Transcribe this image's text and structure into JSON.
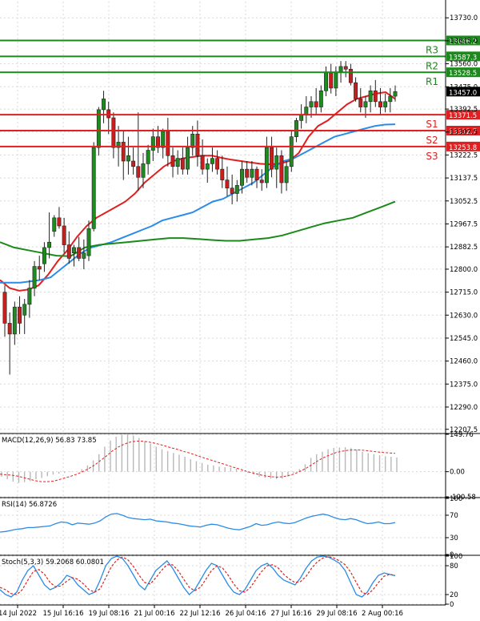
{
  "chart_data": {
    "type": "candlestick",
    "main": {
      "y_ticks": [
        "13730.0",
        "13645.0",
        "13560.0",
        "13475.0",
        "13392.5",
        "13307.5",
        "13222.5",
        "13137.5",
        "13052.5",
        "12967.5",
        "12882.5",
        "12800.0",
        "12715.0",
        "12630.0",
        "12545.0",
        "12460.0",
        "12375.0",
        "12290.0",
        "12207.5"
      ],
      "ylim": [
        12195,
        13790
      ],
      "levels": [
        {
          "name": "R3",
          "value": 13646.2,
          "label": "13646.2",
          "color": "#1a8a1a"
        },
        {
          "name": "R2",
          "value": 13587.3,
          "label": "13587.3",
          "color": "#1a8a1a"
        },
        {
          "name": "R1",
          "value": 13528.5,
          "label": "13528.5",
          "color": "#1a8a1a"
        },
        {
          "name": "S1",
          "value": 13371.5,
          "label": "13371.5",
          "color": "#e02020"
        },
        {
          "name": "S2",
          "value": 13312.7,
          "label": "13312.7",
          "color": "#e02020"
        },
        {
          "name": "S3",
          "value": 13253.8,
          "label": "13253.8",
          "color": "#e02020"
        }
      ],
      "current_price": {
        "value": 13457.0,
        "label": "13457.0"
      },
      "candles": [
        [
          12715,
          12740,
          12550,
          12600
        ],
        [
          12600,
          12640,
          12410,
          12560
        ],
        [
          12560,
          12680,
          12520,
          12660
        ],
        [
          12660,
          12700,
          12560,
          12600
        ],
        [
          12630,
          12690,
          12560,
          12670
        ],
        [
          12670,
          12760,
          12620,
          12730
        ],
        [
          12730,
          12830,
          12700,
          12810
        ],
        [
          12810,
          12850,
          12760,
          12800
        ],
        [
          12820,
          12900,
          12790,
          12880
        ],
        [
          12880,
          13010,
          12840,
          12900
        ],
        [
          12940,
          13000,
          12920,
          12990
        ],
        [
          12990,
          13030,
          12950,
          12960
        ],
        [
          12960,
          12990,
          12860,
          12890
        ],
        [
          12890,
          12940,
          12820,
          12840
        ],
        [
          12860,
          12890,
          12810,
          12880
        ],
        [
          12880,
          12920,
          12830,
          12840
        ],
        [
          12840,
          12910,
          12800,
          12860
        ],
        [
          12850,
          12980,
          12830,
          12950
        ],
        [
          12950,
          13270,
          12940,
          13250
        ],
        [
          13250,
          13400,
          13220,
          13390
        ],
        [
          13390,
          13460,
          13340,
          13430
        ],
        [
          13390,
          13420,
          13300,
          13360
        ],
        [
          13360,
          13380,
          13210,
          13250
        ],
        [
          13250,
          13330,
          13180,
          13270
        ],
        [
          13270,
          13310,
          13130,
          13200
        ],
        [
          13200,
          13290,
          13150,
          13220
        ],
        [
          13200,
          13250,
          13150,
          13180
        ],
        [
          13180,
          13380,
          13090,
          13140
        ],
        [
          13140,
          13230,
          13100,
          13190
        ],
        [
          13190,
          13260,
          13150,
          13240
        ],
        [
          13240,
          13320,
          13200,
          13290
        ],
        [
          13290,
          13330,
          13230,
          13250
        ],
        [
          13250,
          13320,
          13210,
          13310
        ],
        [
          13310,
          13360,
          13180,
          13220
        ],
        [
          13220,
          13250,
          13140,
          13180
        ],
        [
          13180,
          13240,
          13150,
          13210
        ],
        [
          13210,
          13250,
          13150,
          13170
        ],
        [
          13170,
          13290,
          13150,
          13250
        ],
        [
          13250,
          13330,
          13220,
          13300
        ],
        [
          13300,
          13350,
          13180,
          13220
        ],
        [
          13220,
          13280,
          13150,
          13170
        ],
        [
          13170,
          13210,
          13120,
          13190
        ],
        [
          13190,
          13250,
          13160,
          13210
        ],
        [
          13210,
          13240,
          13150,
          13170
        ],
        [
          13170,
          13220,
          13100,
          13130
        ],
        [
          13130,
          13180,
          13070,
          13100
        ],
        [
          13100,
          13150,
          13040,
          13080
        ],
        [
          13080,
          13130,
          13050,
          13110
        ],
        [
          13110,
          13200,
          13080,
          13170
        ],
        [
          13170,
          13200,
          13120,
          13140
        ],
        [
          13140,
          13200,
          13110,
          13170
        ],
        [
          13170,
          13180,
          13100,
          13130
        ],
        [
          13130,
          13170,
          13090,
          13120
        ],
        [
          13120,
          13290,
          13100,
          13250
        ],
        [
          13250,
          13290,
          13140,
          13170
        ],
        [
          13170,
          13250,
          13100,
          13220
        ],
        [
          13220,
          13240,
          13080,
          13120
        ],
        [
          13120,
          13200,
          13090,
          13180
        ],
        [
          13180,
          13310,
          13160,
          13290
        ],
        [
          13290,
          13360,
          13270,
          13350
        ],
        [
          13350,
          13410,
          13320,
          13370
        ],
        [
          13370,
          13440,
          13340,
          13400
        ],
        [
          13400,
          13440,
          13360,
          13420
        ],
        [
          13420,
          13470,
          13370,
          13400
        ],
        [
          13400,
          13480,
          13380,
          13460
        ],
        [
          13460,
          13550,
          13440,
          13530
        ],
        [
          13530,
          13560,
          13450,
          13470
        ],
        [
          13470,
          13550,
          13440,
          13530
        ],
        [
          13530,
          13570,
          13490,
          13550
        ],
        [
          13550,
          13570,
          13510,
          13540
        ],
        [
          13540,
          13560,
          13480,
          13490
        ],
        [
          13490,
          13510,
          13420,
          13430
        ],
        [
          13430,
          13470,
          13380,
          13400
        ],
        [
          13400,
          13440,
          13360,
          13420
        ],
        [
          13420,
          13480,
          13380,
          13460
        ],
        [
          13460,
          13500,
          13400,
          13420
        ],
        [
          13420,
          13470,
          13370,
          13400
        ],
        [
          13400,
          13450,
          13380,
          13420
        ],
        [
          13420,
          13470,
          13380,
          13440
        ],
        [
          13440,
          13480,
          13420,
          13457
        ]
      ],
      "ma": [
        {
          "name": "MA20",
          "color": "#e02020",
          "values": [
            12760,
            12730,
            12720,
            12725,
            12740,
            12780,
            12830,
            12870,
            12920,
            12960,
            12990,
            13010,
            13030,
            13050,
            13080,
            13120,
            13150,
            13180,
            13200,
            13210,
            13215,
            13220,
            13220,
            13212,
            13205,
            13200,
            13195,
            13190,
            13188,
            13190,
            13200,
            13230,
            13290,
            13330,
            13350,
            13380,
            13410,
            13430,
            13440,
            13450,
            13455,
            13430
          ]
        },
        {
          "name": "MA50",
          "color": "#2a8ce6",
          "values": [
            12750,
            12750,
            12750,
            12755,
            12760,
            12770,
            12800,
            12830,
            12860,
            12880,
            12890,
            12900,
            12915,
            12930,
            12945,
            12960,
            12980,
            12990,
            13000,
            13010,
            13030,
            13050,
            13060,
            13080,
            13100,
            13120,
            13150,
            13180,
            13200,
            13210,
            13230,
            13250,
            13270,
            13290,
            13300,
            13310,
            13320,
            13330,
            13335,
            13336
          ]
        },
        {
          "name": "MA200",
          "color": "#1a8a1a",
          "values": [
            12900,
            12880,
            12870,
            12860,
            12850,
            12848,
            12880,
            12890,
            12895,
            12900,
            12905,
            12910,
            12915,
            12915,
            12912,
            12908,
            12905,
            12905,
            12910,
            12915,
            12925,
            12940,
            12955,
            12970,
            12980,
            12990,
            13010,
            13030,
            13050
          ]
        }
      ]
    },
    "macd": {
      "label": "MACD(12,26,9) 56.83 73.85",
      "y_ticks": [
        "149.76",
        "0.00",
        "-100.58"
      ],
      "ylim": [
        -100.58,
        149.76
      ],
      "hist": [
        -20,
        -30,
        -40,
        -45,
        -42,
        -38,
        -30,
        -25,
        -18,
        -12,
        -8,
        -5,
        -2,
        0,
        10,
        25,
        45,
        70,
        100,
        125,
        140,
        148,
        149,
        145,
        135,
        122,
        112,
        100,
        90,
        82,
        75,
        68,
        60,
        50,
        42,
        35,
        28,
        25,
        20,
        18,
        15,
        12,
        5,
        -5,
        -12,
        -20,
        -25,
        -28,
        -30,
        -28,
        -20,
        -5,
        10,
        30,
        55,
        70,
        80,
        90,
        95,
        97,
        98,
        95,
        88,
        80,
        74,
        70,
        66,
        62,
        60,
        57
      ],
      "signal": [
        -10,
        -12,
        -14,
        -18,
        -24,
        -30,
        -36,
        -40,
        -40,
        -38,
        -32,
        -25,
        -18,
        -10,
        0,
        12,
        26,
        44,
        62,
        82,
        98,
        110,
        118,
        122,
        122,
        120,
        115,
        110,
        103,
        96,
        90,
        82,
        76,
        68,
        60,
        52,
        45,
        37,
        30,
        22,
        15,
        8,
        0,
        -6,
        -12,
        -17,
        -20,
        -22,
        -20,
        -15,
        -8,
        3,
        15,
        30,
        45,
        58,
        68,
        77,
        82,
        86,
        87,
        87,
        85,
        82,
        79,
        77,
        75,
        73.85
      ]
    },
    "rsi": {
      "label": "RSI(14) 56.8726",
      "y_ticks": [
        "100",
        "70",
        "30",
        "0"
      ],
      "ylim": [
        0,
        100
      ],
      "values": [
        40,
        41,
        43,
        45,
        46,
        48,
        48,
        49,
        50,
        51,
        55,
        58,
        57,
        53,
        56,
        55,
        54,
        56,
        60,
        67,
        72,
        73,
        70,
        66,
        64,
        63,
        62,
        63,
        60,
        59,
        58,
        56,
        55,
        53,
        51,
        50,
        49,
        52,
        54,
        53,
        50,
        47,
        45,
        44,
        47,
        50,
        55,
        52,
        53,
        56,
        58,
        56,
        55,
        57,
        61,
        65,
        68,
        70,
        72,
        70,
        66,
        63,
        62,
        64,
        62,
        58,
        55,
        56,
        58,
        55,
        55,
        56.87
      ]
    },
    "stoch": {
      "label": "Stoch(5,3,3) 59.2068 60.0801",
      "y_ticks": [
        "100",
        "80",
        "20",
        "0"
      ],
      "ylim": [
        0,
        100
      ],
      "k": [
        30,
        20,
        15,
        25,
        50,
        70,
        80,
        60,
        40,
        30,
        35,
        45,
        60,
        55,
        40,
        30,
        20,
        25,
        50,
        80,
        95,
        100,
        95,
        80,
        60,
        40,
        30,
        50,
        70,
        80,
        90,
        75,
        55,
        35,
        20,
        30,
        50,
        70,
        85,
        80,
        60,
        40,
        25,
        20,
        30,
        50,
        70,
        80,
        85,
        75,
        60,
        50,
        45,
        40,
        55,
        75,
        90,
        98,
        100,
        98,
        92,
        85,
        70,
        45,
        20,
        15,
        25,
        45,
        60,
        65,
        62,
        59.21
      ],
      "d": [
        35,
        30,
        22,
        20,
        30,
        50,
        68,
        72,
        62,
        45,
        36,
        38,
        48,
        55,
        52,
        42,
        30,
        25,
        32,
        55,
        78,
        92,
        98,
        92,
        78,
        60,
        45,
        42,
        55,
        70,
        82,
        82,
        70,
        52,
        35,
        28,
        35,
        52,
        70,
        80,
        75,
        60,
        42,
        28,
        25,
        35,
        52,
        68,
        80,
        82,
        75,
        62,
        52,
        45,
        47,
        58,
        75,
        88,
        96,
        99,
        96,
        90,
        82,
        67,
        45,
        25,
        20,
        30,
        45,
        58,
        62,
        60.08
      ]
    },
    "x_labels": [
      "14 Jul 2022",
      "15 Jul 16:16",
      "19 Jul 08:16",
      "21 Jul 00:16",
      "22 Jul 12:16",
      "26 Jul 04:16",
      "27 Jul 16:16",
      "29 Jul 08:16",
      "2 Aug 00:16"
    ]
  }
}
